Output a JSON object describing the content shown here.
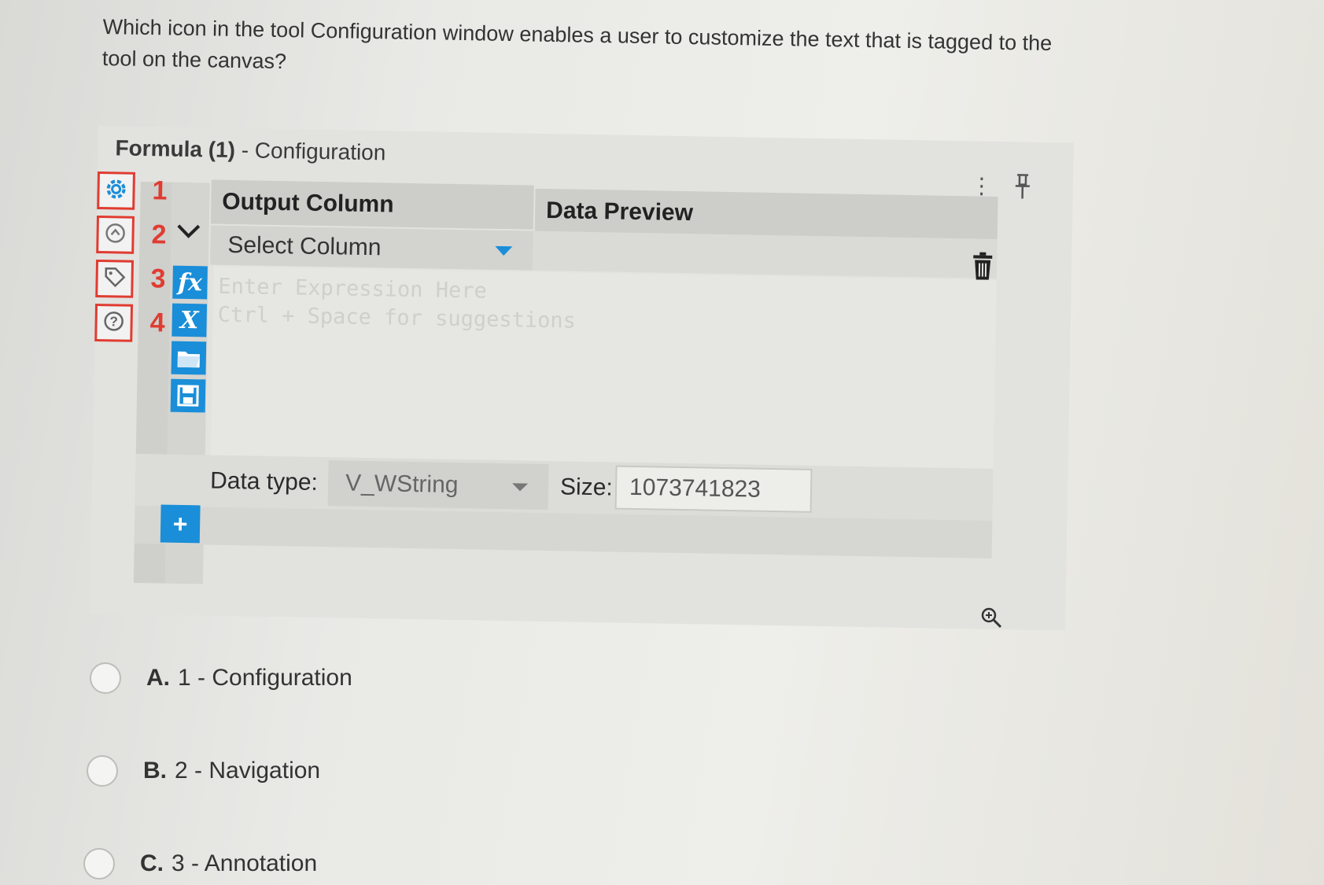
{
  "question": "Which icon in the tool Configuration window enables a user to customize the text that is tagged to the tool on the canvas?",
  "panel": {
    "title_bold": "Formula (1)",
    "title_rest": " - Configuration",
    "kebab": "⋮",
    "pin": "⚲",
    "sidebar": [
      {
        "icon": "gear-icon",
        "glyph": "⚙",
        "num": "1"
      },
      {
        "icon": "navigation-icon",
        "glyph": "⇕",
        "num": "2"
      },
      {
        "icon": "tag-icon",
        "glyph": "⌖",
        "num": "3"
      },
      {
        "icon": "help-icon",
        "glyph": "?",
        "num": "4"
      }
    ],
    "header": {
      "output_column": "Output Column",
      "data_preview": "Data Preview"
    },
    "select_column": "Select Column",
    "expression_placeholder_1": "Enter Expression Here",
    "expression_placeholder_2": "Ctrl + Space for suggestions",
    "tools": {
      "fx": "fx",
      "x": "X",
      "open": "▰",
      "save": "▣"
    },
    "data_type_label": "Data type:",
    "data_type_value": "V_WString",
    "size_label": "Size:",
    "size_value": "1073741823",
    "add": "+",
    "trash": "🗑"
  },
  "zoom_glyph": "🔍",
  "options": [
    {
      "letter": "A.",
      "text": "1 - Configuration"
    },
    {
      "letter": "B.",
      "text": "2 - Navigation"
    },
    {
      "letter": "C.",
      "text": "3 - Annotation"
    }
  ]
}
